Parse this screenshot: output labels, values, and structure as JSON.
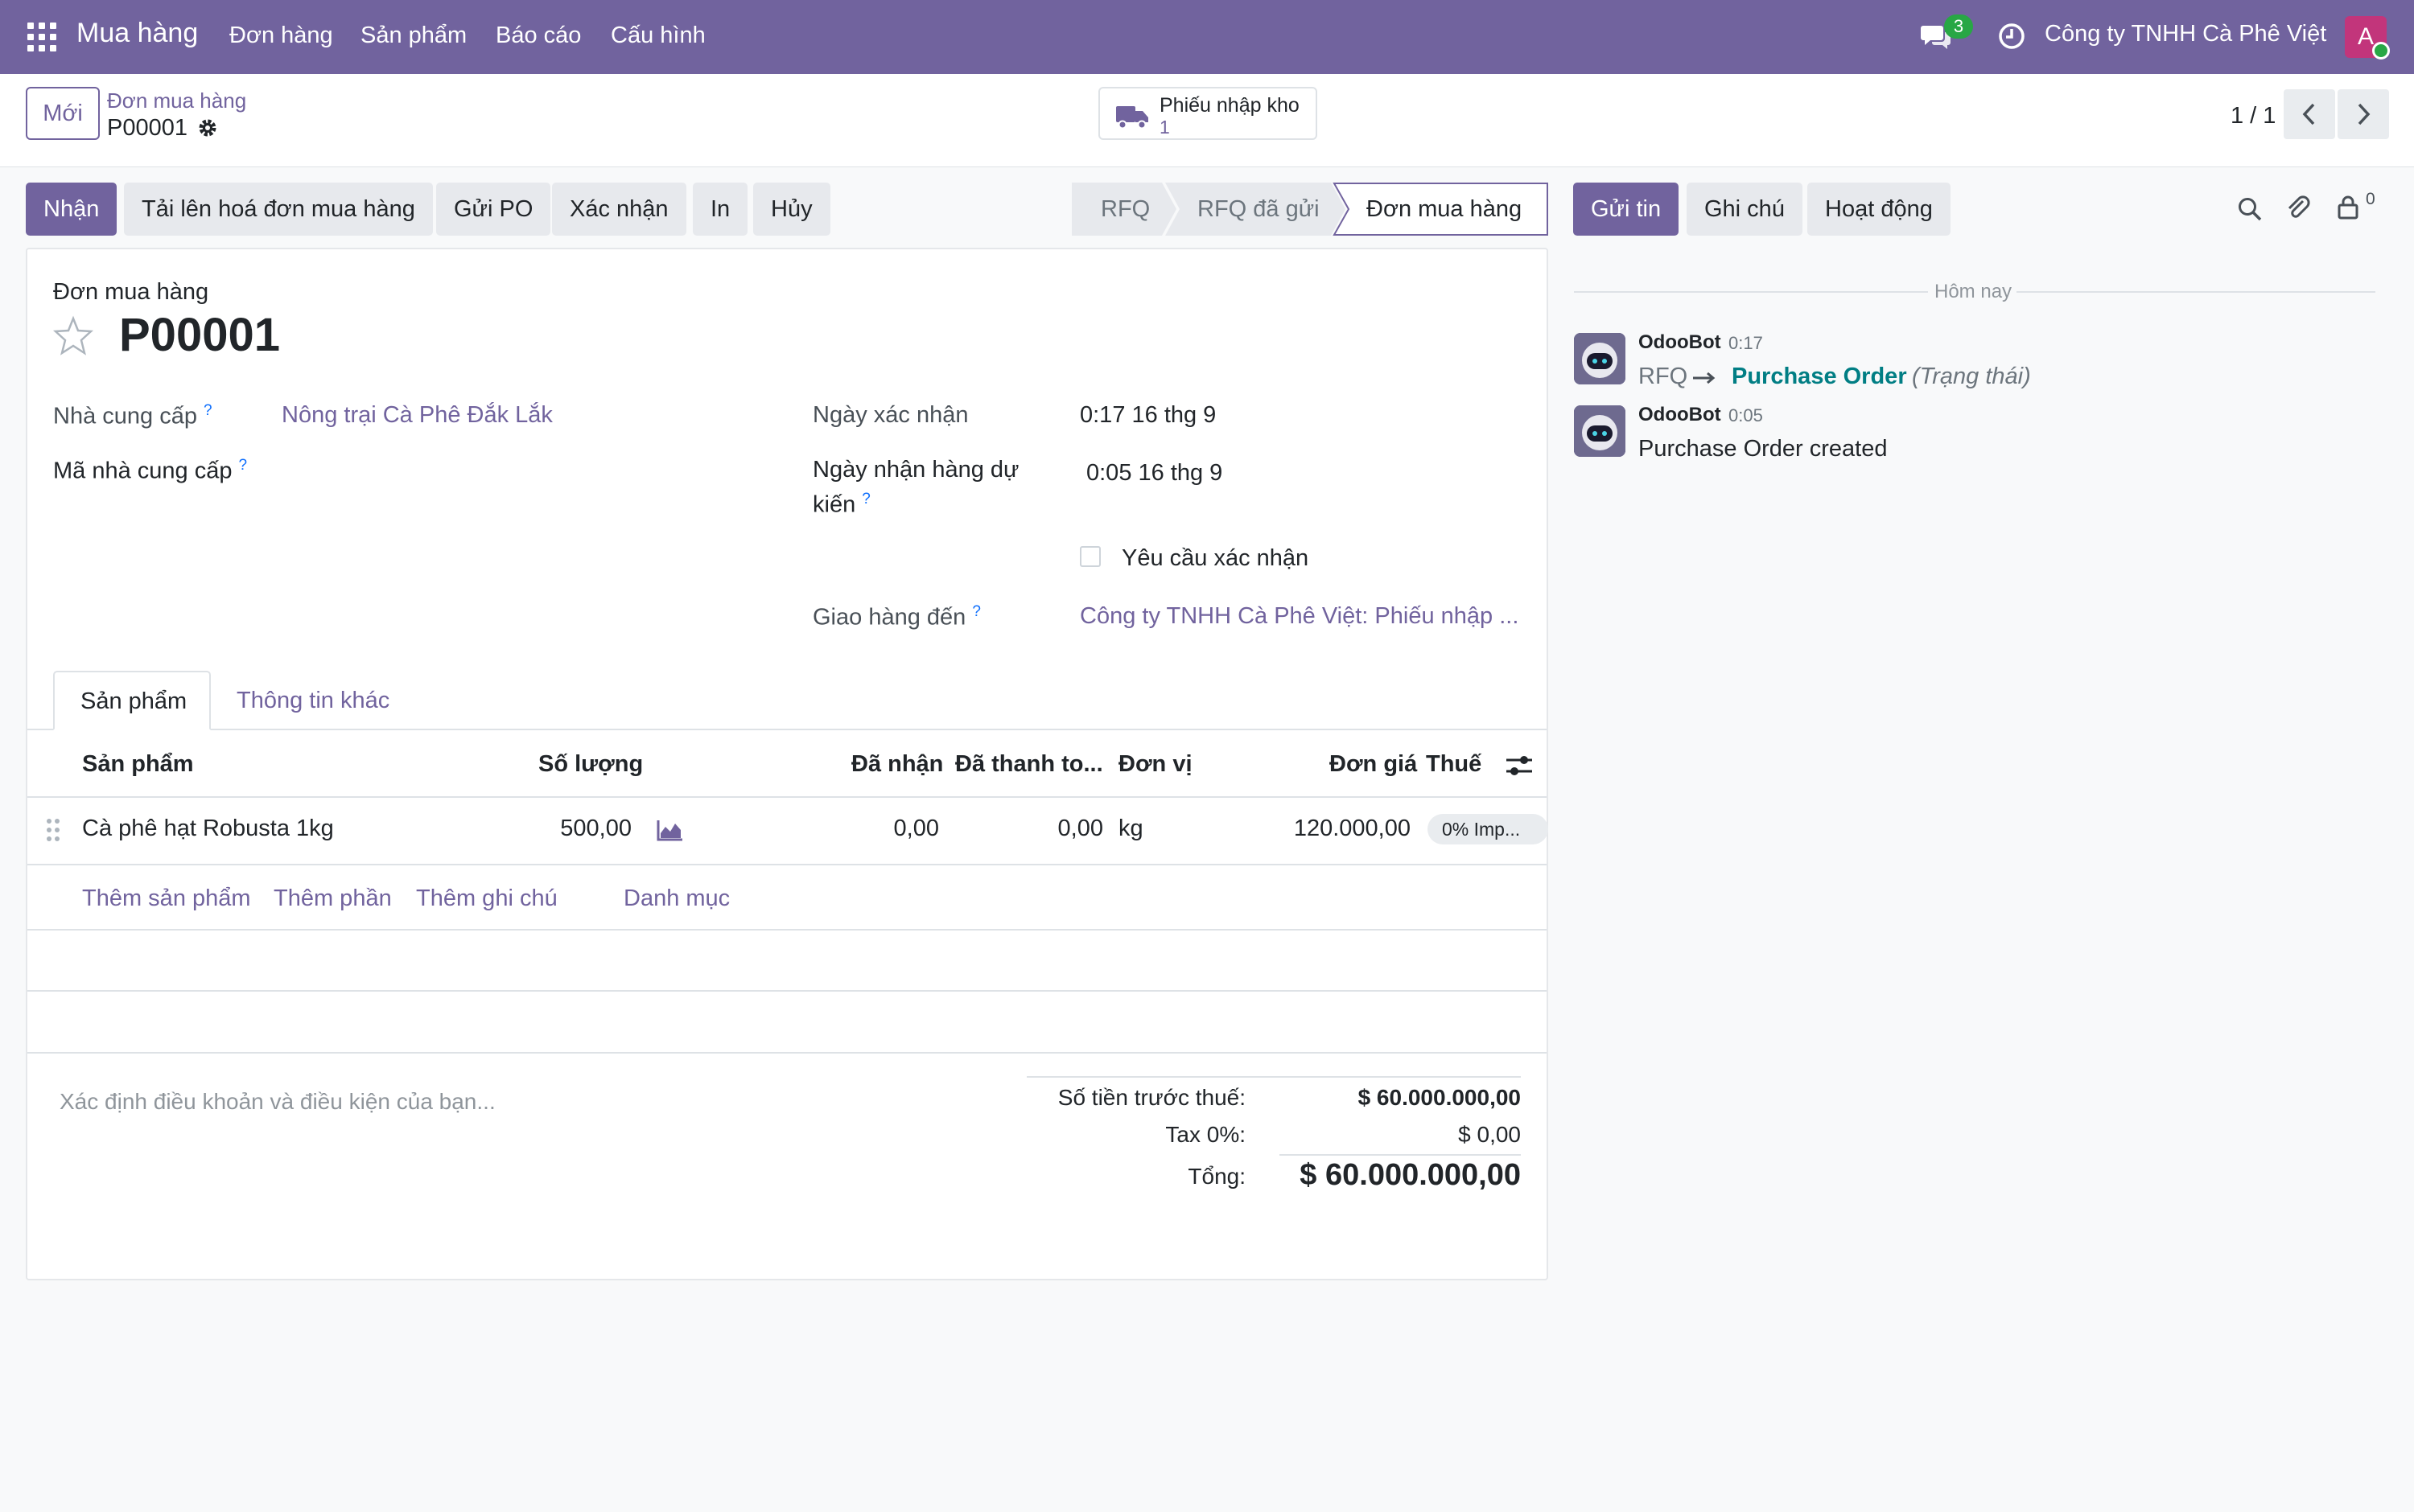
{
  "navbar": {
    "app_name": "Mua hàng",
    "menu": [
      "Đơn hàng",
      "Sản phẩm",
      "Báo cáo",
      "Cấu hình"
    ],
    "chat_count": "3",
    "company": "Công ty TNHH Cà Phê Việt",
    "avatar_letter": "A",
    "bg_color": "#71639e"
  },
  "control": {
    "new_label": "Mới",
    "breadcrumb": "Đơn mua hàng",
    "record_name": "P00001",
    "smart_button": {
      "label": "Phiếu nhập kho",
      "count": "1"
    },
    "pager": "1 / 1"
  },
  "actions": {
    "receive": "Nhận",
    "upload_bill": "Tải lên hoá đơn mua hàng",
    "send_po": "Gửi PO",
    "confirm": "Xác nhận",
    "print": "In",
    "cancel": "Hủy"
  },
  "statusbar": {
    "stages": [
      "RFQ",
      "RFQ đã gửi",
      "Đơn mua hàng"
    ],
    "current": "Đơn mua hàng"
  },
  "form": {
    "type_label": "Đơn mua hàng",
    "name": "P00001",
    "vendor_label": "Nhà cung cấp",
    "vendor_value": "Nông trại Cà Phê Đắk Lắk",
    "vendor_ref_label": "Mã nhà cung cấp",
    "confirm_date_label": "Ngày xác nhận",
    "confirm_date_value": "0:17 16 thg 9",
    "expected_date_label_1": "Ngày nhận hàng dự",
    "expected_date_label_2": "kiến",
    "expected_date_value": "0:05 16 thg 9",
    "ask_confirm_label": "Yêu cầu xác nhận",
    "ask_confirm_checked": false,
    "deliver_to_label": "Giao hàng đến",
    "deliver_to_value": "Công ty TNHH Cà Phê Việt: Phiếu nhập ...",
    "help_mark": "?"
  },
  "tabs": [
    "Sản phẩm",
    "Thông tin khác"
  ],
  "table": {
    "headers": {
      "product": "Sản phẩm",
      "qty": "Số lượng",
      "received": "Đã nhận",
      "billed": "Đã thanh to...",
      "uom": "Đơn vị",
      "price": "Đơn giá",
      "tax": "Thuế"
    },
    "rows": [
      {
        "product": "Cà phê hạt Robusta 1kg",
        "qty": "500,00",
        "received": "0,00",
        "billed": "0,00",
        "uom": "kg",
        "price": "120.000,00",
        "tax": "0% Imp..."
      }
    ],
    "add_links": [
      "Thêm sản phẩm",
      "Thêm phần",
      "Thêm ghi chú",
      "Danh mục"
    ]
  },
  "footer": {
    "terms_placeholder": "Xác định điều khoản và điều kiện của bạn...",
    "untaxed_label": "Số tiền trước thuế:",
    "untaxed_value": "$ 60.000.000,00",
    "tax_label": "Tax 0%:",
    "tax_value": "$ 0,00",
    "total_label": "Tổng:",
    "total_value": "$ 60.000.000,00"
  },
  "chatter": {
    "send_message": "Gửi tin",
    "log_note": "Ghi chú",
    "activity": "Hoạt động",
    "follower_count": "0",
    "date_separator": "Hôm nay",
    "messages": [
      {
        "author": "OdooBot",
        "time": "0:17",
        "from": "RFQ",
        "to": "Purchase Order",
        "field": "(Trạng thái)"
      },
      {
        "author": "OdooBot",
        "time": "0:05",
        "body": "Purchase Order created"
      }
    ]
  }
}
